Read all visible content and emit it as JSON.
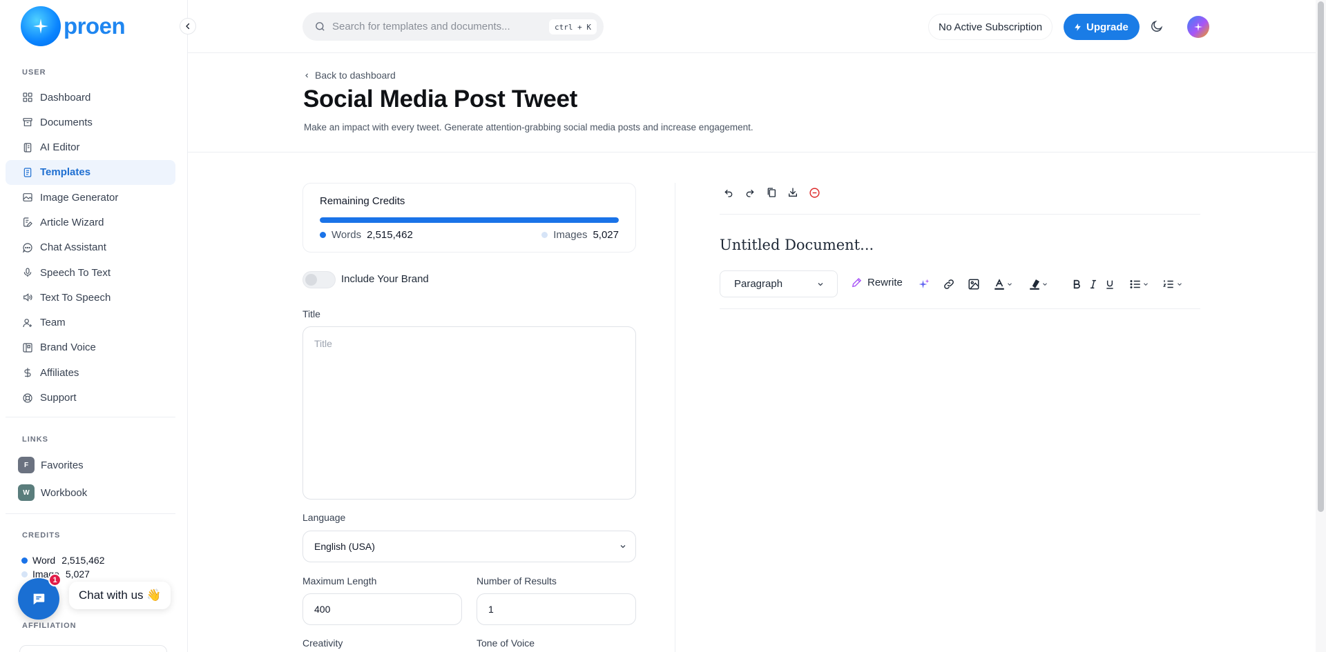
{
  "brand": {
    "name": "proen"
  },
  "sidebar": {
    "user_label": "USER",
    "items": [
      {
        "label": "Dashboard",
        "icon": "grid-icon"
      },
      {
        "label": "Documents",
        "icon": "archive-icon"
      },
      {
        "label": "AI Editor",
        "icon": "notebook-icon"
      },
      {
        "label": "Templates",
        "icon": "file-text-icon"
      },
      {
        "label": "Image Generator",
        "icon": "image-icon"
      },
      {
        "label": "Article Wizard",
        "icon": "file-edit-icon"
      },
      {
        "label": "Chat Assistant",
        "icon": "message-circle-icon"
      },
      {
        "label": "Speech To Text",
        "icon": "microphone-icon"
      },
      {
        "label": "Text To Speech",
        "icon": "volume-icon"
      },
      {
        "label": "Team",
        "icon": "user-plus-icon"
      },
      {
        "label": "Brand Voice",
        "icon": "columns-icon"
      },
      {
        "label": "Affiliates",
        "icon": "dollar-icon"
      },
      {
        "label": "Support",
        "icon": "lifebuoy-icon"
      }
    ],
    "active_index": 3,
    "links_label": "LINKS",
    "links": [
      {
        "badge": "F",
        "label": "Favorites",
        "color": "#6b7280"
      },
      {
        "badge": "W",
        "label": "Workbook",
        "color": "#5a7d7c"
      }
    ],
    "credits_label": "CREDITS",
    "credits": [
      {
        "label": "Word",
        "value": "2,515,462",
        "color": "#1a73e8"
      },
      {
        "label": "Image",
        "value": "5,027",
        "color": "#d6e4f7"
      }
    ],
    "affiliation_label": "AFFILIATION"
  },
  "chat_widget": {
    "label": "Chat with us 👋",
    "badge": "1"
  },
  "topbar": {
    "search_placeholder": "Search for templates and documents...",
    "shortcut": "ctrl + K",
    "subscription": "No Active Subscription",
    "upgrade": "Upgrade"
  },
  "header": {
    "back": "Back to dashboard",
    "title": "Social Media Post Tweet",
    "description": "Make an impact with every tweet. Generate attention-grabbing social media posts and increase engagement."
  },
  "credits_card": {
    "title": "Remaining Credits",
    "words_label": "Words",
    "words_value": "2,515,462",
    "images_label": "Images",
    "images_value": "5,027",
    "words_fraction": 1.0,
    "colors": {
      "words": "#1a73e8",
      "images": "#d6e4f7"
    }
  },
  "form": {
    "brand_toggle_label": "Include Your Brand",
    "brand_toggle_on": false,
    "title_label": "Title",
    "title_placeholder": "Title",
    "language_label": "Language",
    "language_value": "English (USA)",
    "max_length_label": "Maximum Length",
    "max_length_value": "400",
    "num_results_label": "Number of Results",
    "num_results_value": "1",
    "creativity_label": "Creativity",
    "tone_label": "Tone of Voice"
  },
  "editor": {
    "doc_title": "Untitled Document...",
    "block_type": "Paragraph",
    "rewrite": "Rewrite"
  },
  "colors": {
    "accent": "#1a7ce6",
    "brand": "#1f86f0",
    "danger": "#dc2626"
  }
}
